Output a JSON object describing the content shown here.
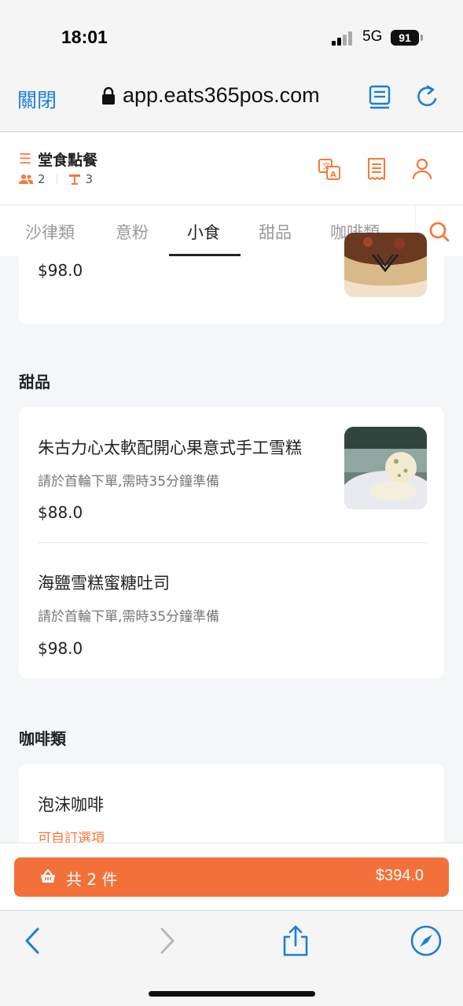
{
  "status": {
    "time": "18:01",
    "network": "5G",
    "battery": "91"
  },
  "browser": {
    "close_label": "關閉",
    "url": "app.eats365pos.com"
  },
  "header": {
    "mode_title": "堂食點餐",
    "guests": "2",
    "table": "3",
    "icons": [
      "translate-icon",
      "receipt-icon",
      "user-icon"
    ]
  },
  "tabs": [
    {
      "label": "沙律類"
    },
    {
      "label": "意粉"
    },
    {
      "label": "小食",
      "active": true
    },
    {
      "label": "甜品"
    },
    {
      "label": "咖啡類"
    }
  ],
  "snacks_partial": {
    "price": "$98.0"
  },
  "desserts": {
    "title": "甜品",
    "items": [
      {
        "name": "朱古力心太軟配開心果意式手工雪糕",
        "note": "請於首輪下單,需時35分鐘準備",
        "price": "$88.0"
      },
      {
        "name": "海鹽雪糕蜜糖吐司",
        "note": "請於首輪下單,需時35分鐘準備",
        "price": "$98.0"
      }
    ]
  },
  "coffee": {
    "title": "咖啡類",
    "items": [
      {
        "name": "泡沫咖啡",
        "option": "可自訂選項"
      }
    ]
  },
  "cart": {
    "count_label": "共 2 件",
    "total": "$394.0"
  },
  "colors": {
    "accent": "#f37139",
    "link": "#1a7fd6",
    "background": "#f4f6f9"
  }
}
